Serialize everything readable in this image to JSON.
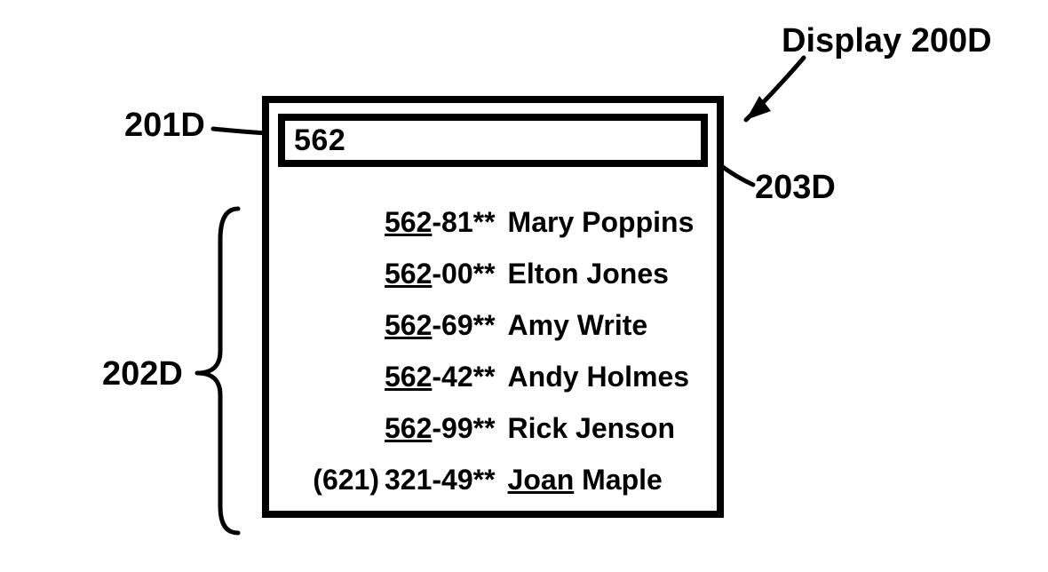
{
  "labels": {
    "display": "Display 200D",
    "inputRef": "201D",
    "listRef": "202D",
    "boxRef": "203D"
  },
  "input": {
    "value": "562"
  },
  "matches": [
    {
      "area": "",
      "num_ul": "562",
      "num_rest": "-81**",
      "name_ul": "",
      "name_rest": "Mary Poppins"
    },
    {
      "area": "",
      "num_ul": "562",
      "num_rest": "-00**",
      "name_ul": "",
      "name_rest": "Elton Jones"
    },
    {
      "area": "",
      "num_ul": "562",
      "num_rest": "-69**",
      "name_ul": "",
      "name_rest": "Amy Write"
    },
    {
      "area": "",
      "num_ul": "562",
      "num_rest": "-42**",
      "name_ul": "",
      "name_rest": "Andy Holmes"
    },
    {
      "area": "",
      "num_ul": "562",
      "num_rest": "-99**",
      "name_ul": "",
      "name_rest": "Rick Jenson"
    },
    {
      "area": "(621)",
      "num_ul": "",
      "num_rest": "321-49**",
      "name_ul": "Joan",
      "name_rest": " Maple"
    }
  ]
}
